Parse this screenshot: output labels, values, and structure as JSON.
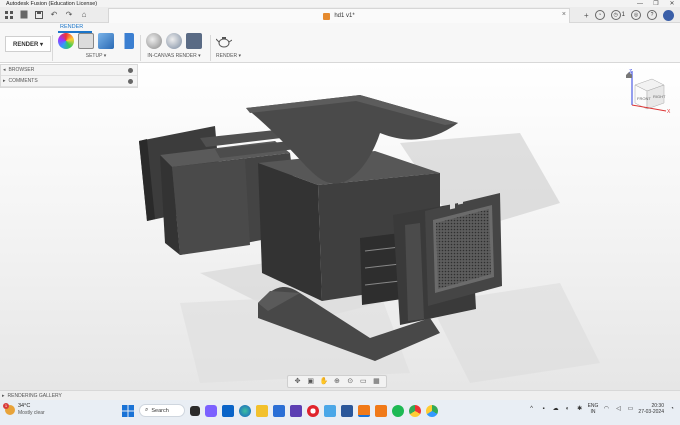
{
  "window": {
    "title": "Autodesk Fusion (Education License)",
    "controls": [
      "—",
      "❐",
      "✕"
    ]
  },
  "document": {
    "tab_name": "hd1 v1*",
    "close": "×"
  },
  "right_toolbar": {
    "job_count": "1",
    "help": "?"
  },
  "ribbon": {
    "active_tab": "RENDER",
    "workspace_button": "RENDER ▾",
    "groups": {
      "setup": "SETUP ▾",
      "in_canvas": "IN-CANVAS RENDER ▾",
      "render": "RENDER ▾"
    }
  },
  "browser": {
    "rows": [
      {
        "label": "BROWSER"
      },
      {
        "label": "COMMENTS"
      }
    ]
  },
  "viewcube": {
    "top": "TOP",
    "front": "FRONT",
    "right": "RIGHT",
    "axis_z": "Z",
    "axis_x": "X"
  },
  "rendering_gallery": "RENDERING GALLERY",
  "taskbar": {
    "weather": {
      "temp": "34°C",
      "condition": "Mostly clear",
      "badge": "1"
    },
    "search_label": "Search",
    "lang": [
      "ENG",
      "IN"
    ],
    "time": "20:30",
    "date": "27-03-2024"
  },
  "colors": {
    "accent": "#1b75c9",
    "model_dark": "#3e3e3e",
    "model_mid": "#555555",
    "background": "#f2f2f2"
  }
}
